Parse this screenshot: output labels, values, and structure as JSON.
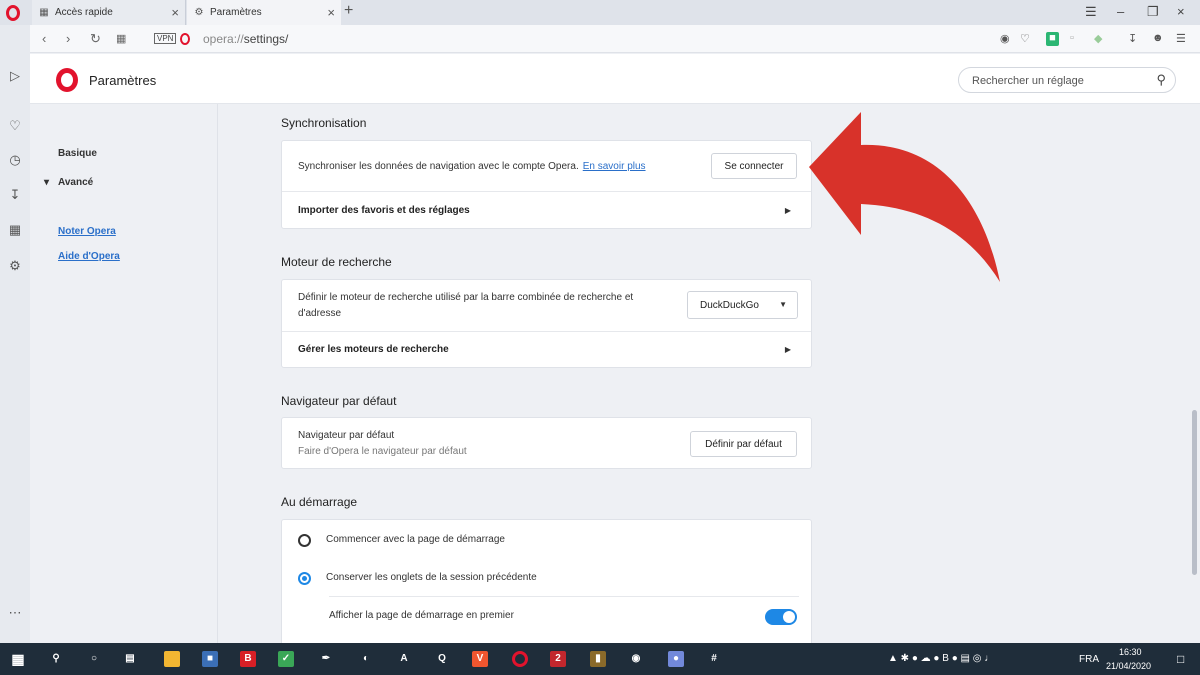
{
  "tabs": [
    {
      "label": "Accès rapide"
    },
    {
      "label": "Paramètres"
    }
  ],
  "addressbar": {
    "vpn": "VPN",
    "url_prefix": "opera://",
    "url_rest": "settings/"
  },
  "header": {
    "title": "Paramètres",
    "search_placeholder": "Rechercher un réglage"
  },
  "leftnav": {
    "basic": "Basique",
    "advanced": "Avancé",
    "rate": "Noter Opera",
    "help": "Aide d'Opera"
  },
  "sync": {
    "title": "Synchronisation",
    "text": "Synchroniser les données de navigation avec le compte Opera.",
    "learn_more": "En savoir plus",
    "connect_button": "Se connecter",
    "import": "Importer des favoris et des réglages"
  },
  "search_engine": {
    "title": "Moteur de recherche",
    "text_line1": "Définir le moteur de recherche utilisé par la barre combinée de recherche et",
    "text_line2": "d'adresse",
    "selected": "DuckDuckGo",
    "manage": "Gérer les moteurs de recherche"
  },
  "default_browser": {
    "title": "Navigateur par défaut",
    "label": "Navigateur par défaut",
    "sub": "Faire d'Opera le navigateur par défaut",
    "button": "Définir par défaut"
  },
  "startup": {
    "title": "Au démarrage",
    "opt1": "Commencer avec la page de démarrage",
    "opt2": "Conserver les onglets de la session précédente",
    "opt3": "Afficher la page de démarrage en premier",
    "selected_option": 2,
    "show_start_first": true
  },
  "taskbar": {
    "lang": "FRA",
    "time": "16:30",
    "date": "21/04/2020"
  },
  "colors": {
    "accent": "#1e88e5",
    "opera_red": "#e2132d",
    "link": "#2a6fc9",
    "arrow": "#d8322a"
  }
}
